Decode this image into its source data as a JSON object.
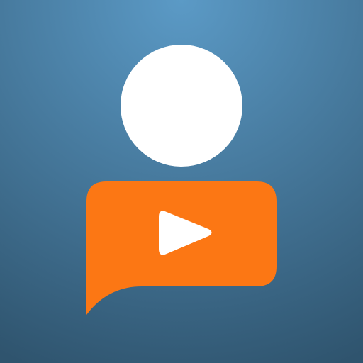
{
  "icon": {
    "background_center_color": "#5b9ac6",
    "background_edge_color": "#2f546e",
    "head_color": "#ffffff",
    "bubble_color": "#fc7714",
    "play_color": "#ffffff",
    "icons": [
      "person-head-icon",
      "speech-bubble-icon",
      "play-icon"
    ]
  }
}
